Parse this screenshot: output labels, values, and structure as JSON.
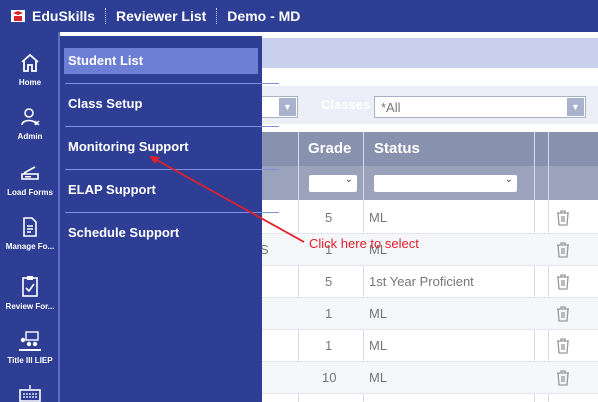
{
  "topbar": {
    "app_name": "EduSkills",
    "section": "Reviewer List",
    "district": "Demo - MD"
  },
  "rail": {
    "items": [
      {
        "label": "Home",
        "icon": "home-icon"
      },
      {
        "label": "Admin",
        "icon": "admin-user-icon"
      },
      {
        "label": "Load Forms",
        "icon": "scanner-icon"
      },
      {
        "label": "Manage Fo...",
        "icon": "document-icon"
      },
      {
        "label": "Review For...",
        "icon": "clipboard-check-icon"
      },
      {
        "label": "Title III LIEP",
        "icon": "classroom-icon"
      },
      {
        "label": "",
        "icon": "keyboard-icon"
      }
    ]
  },
  "filters": {
    "classes_label": "Classes",
    "classes_value": "*All"
  },
  "table": {
    "headers": {
      "grade": "Grade",
      "status": "Status"
    },
    "rows": [
      {
        "grade": "5",
        "status": "ML",
        "name_fragment": ""
      },
      {
        "grade": "1",
        "status": "ML",
        "name_fragment": "S"
      },
      {
        "grade": "5",
        "status": "1st Year Proficient",
        "name_fragment": ""
      },
      {
        "grade": "1",
        "status": "ML",
        "name_fragment": ""
      },
      {
        "grade": "1",
        "status": "ML",
        "name_fragment": ""
      },
      {
        "grade": "10",
        "status": "ML",
        "name_fragment": ""
      }
    ]
  },
  "menu": {
    "items": [
      {
        "label": "Student List",
        "active": true
      },
      {
        "label": "Class Setup",
        "active": false
      },
      {
        "label": "Monitoring Support",
        "active": false
      },
      {
        "label": "ELAP Support",
        "active": false
      },
      {
        "label": "Schedule Support",
        "active": false
      }
    ]
  },
  "annotation": {
    "text": "Click here to select"
  },
  "colors": {
    "nav_bg": "#2e3e94",
    "menu_active": "#6d7fd4",
    "table_header": "#8891ad",
    "annotation": "#e0202a"
  }
}
